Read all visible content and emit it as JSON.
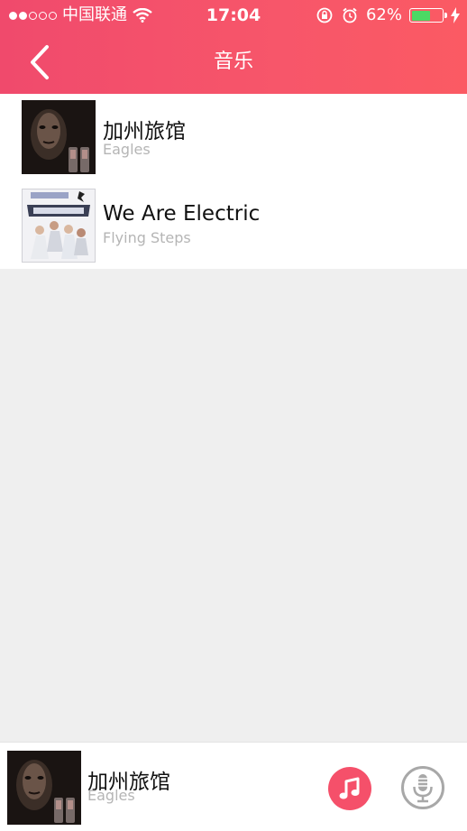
{
  "status_bar": {
    "carrier": "中国联通",
    "time": "17:04",
    "battery_percent": "62%",
    "battery_level": 0.62,
    "signal_bars": 2
  },
  "nav": {
    "title": "音乐",
    "back_icon": "chevron-left-icon"
  },
  "songs": [
    {
      "title": "加州旅馆",
      "artist": "Eagles",
      "cover": "portrait-album-cover"
    },
    {
      "title": "We Are Electric",
      "artist": "Flying Steps",
      "cover": "group-album-cover"
    }
  ],
  "now_playing": {
    "title": "加州旅馆",
    "artist": "Eagles",
    "music_icon": "music-note-icon",
    "mic_icon": "microphone-icon"
  },
  "colors": {
    "header": "#f5506a",
    "accent": "#f5506a",
    "artist_text": "#b5b5b5",
    "background": "#efefef"
  }
}
